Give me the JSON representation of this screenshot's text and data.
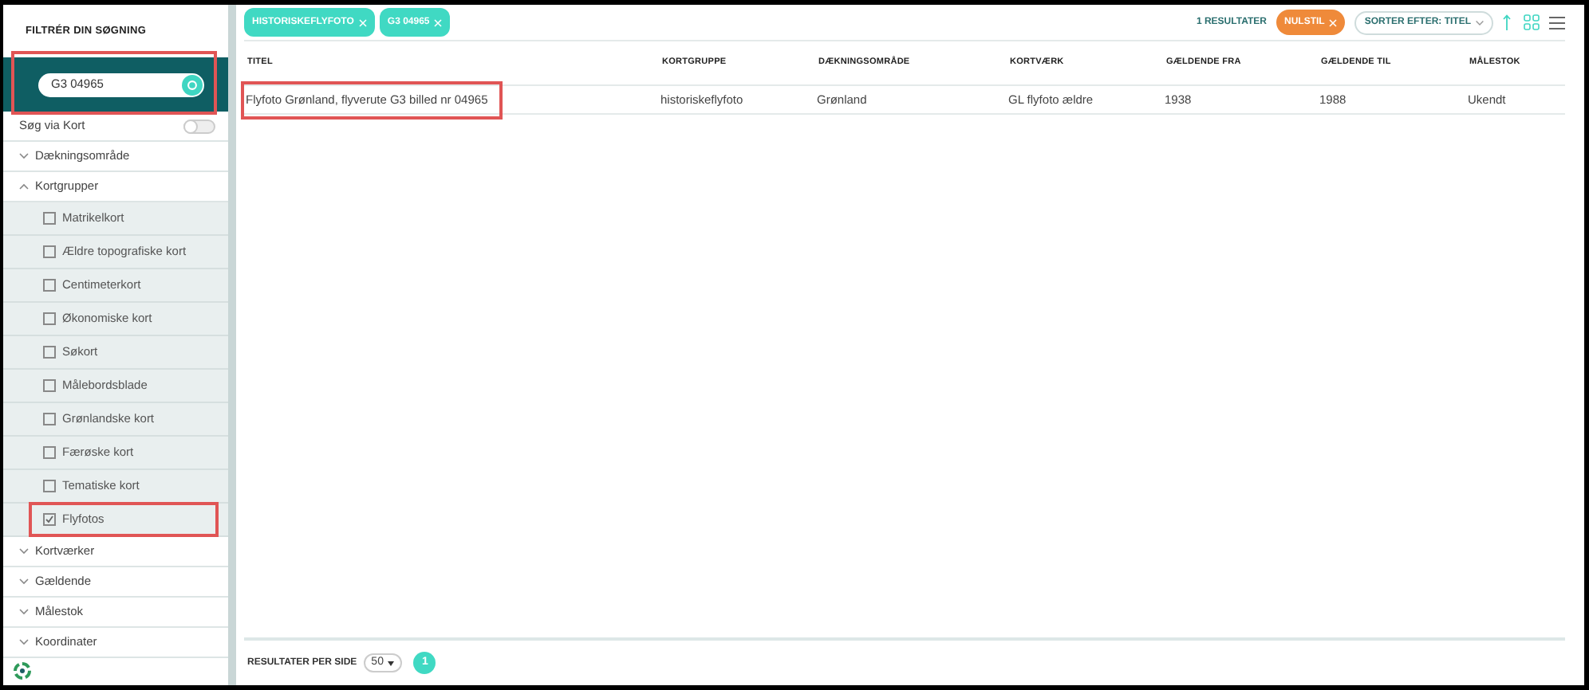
{
  "sidebar": {
    "title": "FILTRÉR DIN SØGNING",
    "search": {
      "value": "G3 04965",
      "highlighted": true
    },
    "map_toggle": {
      "label": "Søg via Kort",
      "on": false
    },
    "sections": [
      {
        "label": "Dækningsområde",
        "expanded": false
      },
      {
        "label": "Kortgrupper",
        "expanded": true,
        "children": [
          {
            "label": "Matrikelkort",
            "checked": false,
            "highlighted": false
          },
          {
            "label": "Ældre topografiske kort",
            "checked": false,
            "highlighted": false
          },
          {
            "label": "Centimeterkort",
            "checked": false,
            "highlighted": false
          },
          {
            "label": "Økonomiske kort",
            "checked": false,
            "highlighted": false
          },
          {
            "label": "Søkort",
            "checked": false,
            "highlighted": false
          },
          {
            "label": "Målebordsblade",
            "checked": false,
            "highlighted": false
          },
          {
            "label": "Grønlandske kort",
            "checked": false,
            "highlighted": false
          },
          {
            "label": "Færøske kort",
            "checked": false,
            "highlighted": false
          },
          {
            "label": "Tematiske kort",
            "checked": false,
            "highlighted": false
          },
          {
            "label": "Flyfotos",
            "checked": true,
            "highlighted": true
          }
        ]
      },
      {
        "label": "Kortværker",
        "expanded": false
      },
      {
        "label": "Gældende",
        "expanded": false
      },
      {
        "label": "Målestok",
        "expanded": false
      },
      {
        "label": "Koordinater",
        "expanded": false
      }
    ]
  },
  "chips": [
    "HISTORISKEFLYFOTO",
    "G3 04965"
  ],
  "toolbar": {
    "result_count": "1 RESULTATER",
    "reset": "NULSTIL",
    "sort": "SORTER EFTER: TITEL"
  },
  "table": {
    "columns": [
      "TITEL",
      "KORTGRUPPE",
      "DÆKNINGSOMRÅDE",
      "KORTVÆRK",
      "GÆLDENDE FRA",
      "GÆLDENDE TIL",
      "MÅLESTOK"
    ],
    "rows": [
      {
        "cells": [
          "Flyfoto Grønland, flyverute G3 billed nr 04965",
          "historiskeflyfoto",
          "Grønland",
          "GL flyfoto ældre",
          "1938",
          "1988",
          "Ukendt"
        ],
        "highlighted": true
      }
    ]
  },
  "footer": {
    "label": "RESULTATER PER SIDE",
    "per_page": "50",
    "pages": [
      {
        "label": "1",
        "selected": true
      }
    ]
  }
}
